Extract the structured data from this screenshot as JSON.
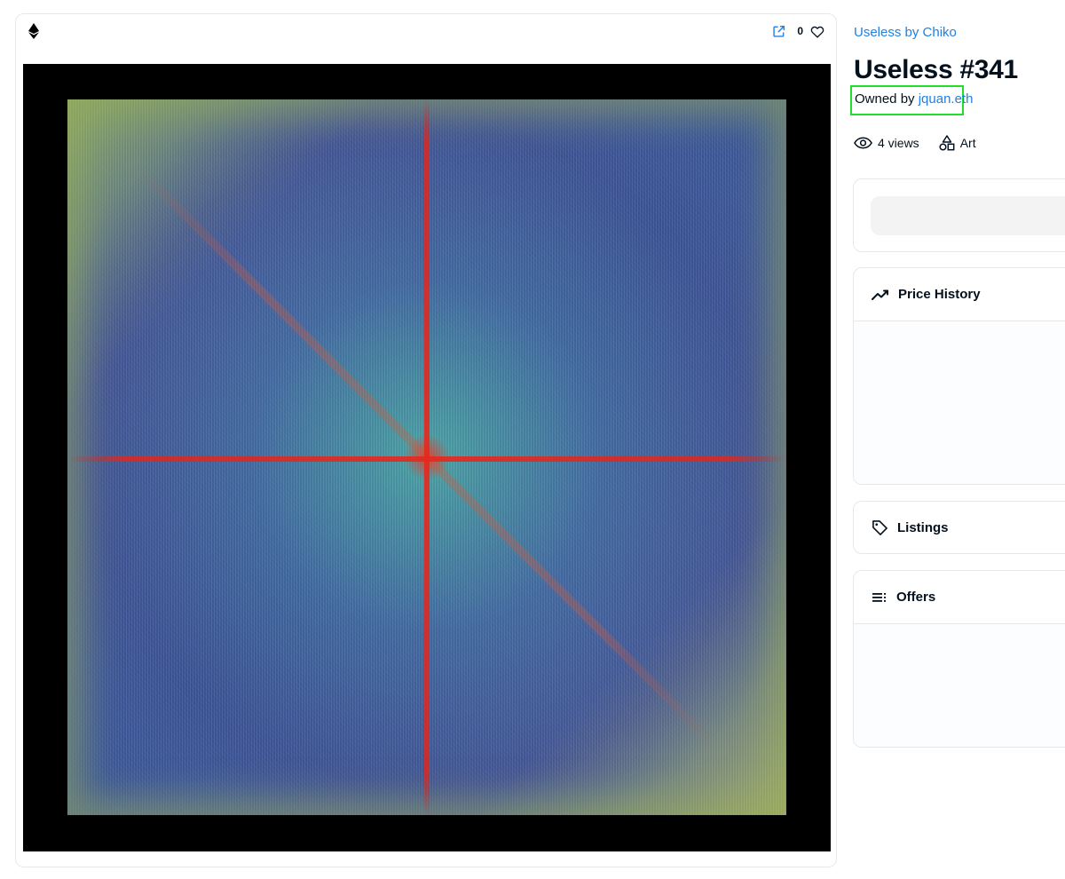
{
  "media": {
    "chain_icon": "ethereum-icon",
    "external_link_icon": "external-link-icon",
    "favorite_count": "0",
    "favorite_icon": "heart-icon",
    "artwork_alt": "Useless #341"
  },
  "details": {
    "collection_name": "Useless by Chiko",
    "item_title": "Useless #341",
    "owner_prefix": "Owned by",
    "owner_name": "jquan.eth",
    "views": "4 views",
    "category": "Art"
  },
  "panels": {
    "price_history": "Price History",
    "listings": "Listings",
    "offers": "Offers"
  },
  "colors": {
    "link": "#2081e2",
    "highlight_box": "#22e02a",
    "border": "#e5e8eb",
    "text": "#04111d"
  }
}
